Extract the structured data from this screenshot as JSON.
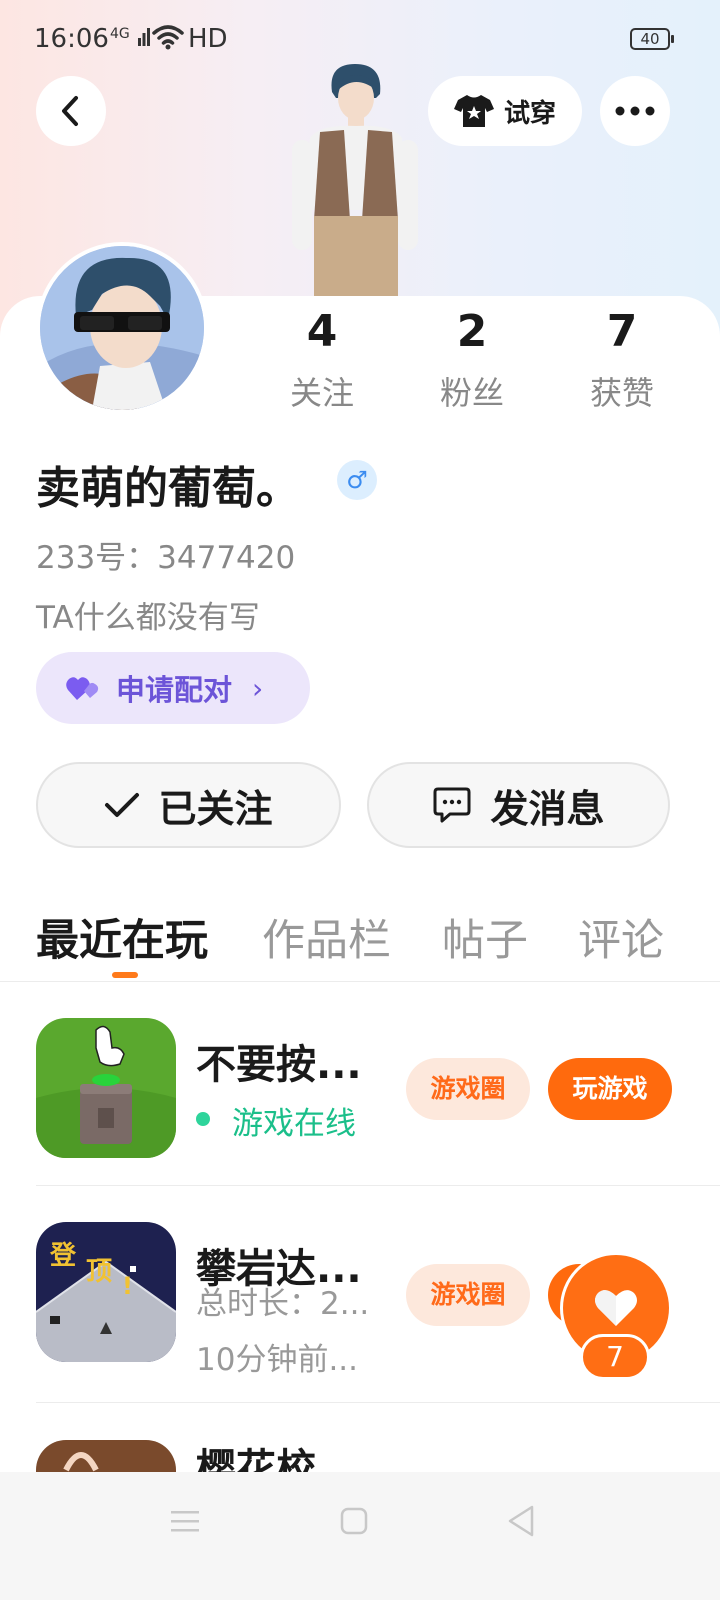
{
  "status_bar": {
    "time": "16:06",
    "network": "4G",
    "hd": "HD",
    "battery": "40"
  },
  "header": {
    "tryon_label": "试穿"
  },
  "profile": {
    "stats": [
      {
        "value": "4",
        "label": "关注"
      },
      {
        "value": "2",
        "label": "粉丝"
      },
      {
        "value": "7",
        "label": "获赞"
      }
    ],
    "username": "卖萌的葡萄。",
    "gender_symbol": "♂",
    "uid": "233号：3477420",
    "bio": "TA什么都没有写",
    "pair_label": "申请配对"
  },
  "actions": {
    "follow_label": "已关注",
    "message_label": "发消息"
  },
  "tabs": [
    {
      "label": "最近在玩",
      "active": true
    },
    {
      "label": "作品栏",
      "active": false
    },
    {
      "label": "帖子",
      "active": false
    },
    {
      "label": "评论",
      "active": false
    }
  ],
  "games": [
    {
      "title": "不要按...",
      "status": "游戏在线",
      "circle_label": "游戏圈",
      "play_label": "玩游戏"
    },
    {
      "title": "攀岩达...",
      "playtime": "总时长：2...",
      "last_played": "10分钟前...",
      "circle_label": "游戏圈",
      "icon_text_1": "登",
      "icon_text_2": "顶",
      "icon_text_3": "!"
    },
    {
      "title": "樱花校..."
    }
  ],
  "like_fab": {
    "count": "7"
  },
  "colors": {
    "accent": "#ff6a0d",
    "online": "#1bbf8a",
    "pair": "#6c54d8"
  }
}
